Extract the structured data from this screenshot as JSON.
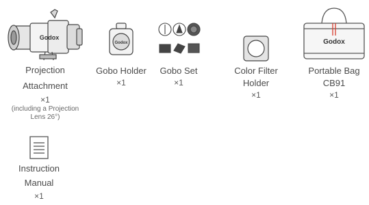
{
  "heading_fragment": "",
  "items": [
    {
      "name_lines": [
        "Projection",
        "Attachment"
      ],
      "qty": "×1",
      "note_lines": [
        "(including a Projection",
        "Lens 26°)"
      ]
    },
    {
      "name_lines": [
        "Gobo Holder"
      ],
      "qty": "×1"
    },
    {
      "name_lines": [
        "Gobo Set"
      ],
      "qty": "×1"
    },
    {
      "name_lines": [
        "Color Filter",
        "Holder"
      ],
      "qty": "×1"
    },
    {
      "name_lines": [
        "Portable Bag",
        "CB91"
      ],
      "qty": "×1"
    },
    {
      "name_lines": [
        "Instruction",
        "Manual"
      ],
      "qty": "×1"
    }
  ],
  "brand_logo_text": "Godox",
  "colors": {
    "bag_handle": "#d83a2b",
    "line": "#555555",
    "text": "#4a4a4a"
  }
}
